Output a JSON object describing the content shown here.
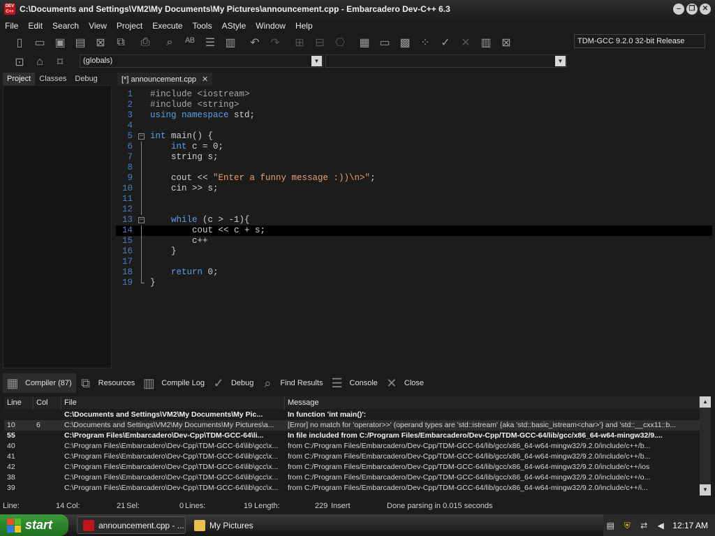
{
  "window": {
    "title": "C:\\Documents and Settings\\VM2\\My Documents\\My Pictures\\announcement.cpp - Embarcadero Dev-C++ 6.3",
    "app_icon_text": "DEV C++",
    "controls": [
      "‒",
      "❐",
      "✕"
    ]
  },
  "menu": [
    "File",
    "Edit",
    "Search",
    "View",
    "Project",
    "Execute",
    "Tools",
    "AStyle",
    "Window",
    "Help"
  ],
  "toolbar": {
    "compiler": "TDM-GCC 9.2.0 32-bit Release",
    "scope": "(globals)"
  },
  "left_tabs": [
    "Project",
    "Classes",
    "Debug"
  ],
  "editor_tab": {
    "label": "[*] announcement.cpp",
    "close": "✕"
  },
  "code_lines": [
    {
      "n": "1",
      "text": "#include <iostream>"
    },
    {
      "n": "2",
      "text": "#include <string>"
    },
    {
      "n": "3",
      "text": "using namespace std;"
    },
    {
      "n": "4",
      "text": ""
    },
    {
      "n": "5",
      "text": "int main() {"
    },
    {
      "n": "6",
      "text": "    int c = 0;"
    },
    {
      "n": "7",
      "text": "    string s;"
    },
    {
      "n": "8",
      "text": ""
    },
    {
      "n": "9",
      "text": "    cout << \"Enter a funny message :))\\n>\";"
    },
    {
      "n": "10",
      "text": "    cin >> s;"
    },
    {
      "n": "11",
      "text": ""
    },
    {
      "n": "12",
      "text": ""
    },
    {
      "n": "13",
      "text": "    while (c > -1){"
    },
    {
      "n": "14",
      "text": "        cout << c + s;"
    },
    {
      "n": "15",
      "text": "        c++"
    },
    {
      "n": "16",
      "text": "    }"
    },
    {
      "n": "17",
      "text": ""
    },
    {
      "n": "18",
      "text": "    return 0;"
    },
    {
      "n": "19",
      "text": "}"
    }
  ],
  "bottom_tabs": [
    {
      "label": "Compiler (87)",
      "icon": "grid-icon"
    },
    {
      "label": "Resources",
      "icon": "resources-icon"
    },
    {
      "label": "Compile Log",
      "icon": "bar-chart-icon"
    },
    {
      "label": "Debug",
      "icon": "check-icon"
    },
    {
      "label": "Find Results",
      "icon": "find-icon"
    },
    {
      "label": "Console",
      "icon": "console-icon"
    },
    {
      "label": "Close",
      "icon": "close-icon"
    }
  ],
  "messages": {
    "headers": [
      "Line",
      "Col",
      "File",
      "Message"
    ],
    "rows": [
      {
        "line": "",
        "col": "",
        "file": "C:\\Documents and Settings\\VM2\\My Documents\\My Pic...",
        "msg": "In function 'int main()':",
        "bold": true
      },
      {
        "line": "10",
        "col": "6",
        "file": "C:\\Documents and Settings\\VM2\\My Documents\\My Pictures\\a...",
        "msg": "[Error] no match for 'operator>>' (operand types are 'std::istream' {aka 'std::basic_istream<char>'} and 'std::__cxx11::b...",
        "bold": false
      },
      {
        "line": "55",
        "col": "",
        "file": "C:\\Program Files\\Embarcadero\\Dev-Cpp\\TDM-GCC-64\\li...",
        "msg": "In file included from C:/Program Files/Embarcadero/Dev-Cpp/TDM-GCC-64/lib/gcc/x86_64-w64-mingw32/9....",
        "bold": true
      },
      {
        "line": "40",
        "col": "",
        "file": "C:\\Program Files\\Embarcadero\\Dev-Cpp\\TDM-GCC-64\\lib\\gcc\\x...",
        "msg": "             from C:/Program Files/Embarcadero/Dev-Cpp/TDM-GCC-64/lib/gcc/x86_64-w64-mingw32/9.2.0/include/c++/b...",
        "bold": false
      },
      {
        "line": "41",
        "col": "",
        "file": "C:\\Program Files\\Embarcadero\\Dev-Cpp\\TDM-GCC-64\\lib\\gcc\\x...",
        "msg": "             from C:/Program Files/Embarcadero/Dev-Cpp/TDM-GCC-64/lib/gcc/x86_64-w64-mingw32/9.2.0/include/c++/b...",
        "bold": false
      },
      {
        "line": "42",
        "col": "",
        "file": "C:\\Program Files\\Embarcadero\\Dev-Cpp\\TDM-GCC-64\\lib\\gcc\\x...",
        "msg": "             from C:/Program Files/Embarcadero/Dev-Cpp/TDM-GCC-64/lib/gcc/x86_64-w64-mingw32/9.2.0/include/c++/ios",
        "bold": false
      },
      {
        "line": "38",
        "col": "",
        "file": "C:\\Program Files\\Embarcadero\\Dev-Cpp\\TDM-GCC-64\\lib\\gcc\\x...",
        "msg": "             from C:/Program Files/Embarcadero/Dev-Cpp/TDM-GCC-64/lib/gcc/x86_64-w64-mingw32/9.2.0/include/c++/o...",
        "bold": false
      },
      {
        "line": "39",
        "col": "",
        "file": "C:\\Program Files\\Embarcadero\\Dev-Cpp\\TDM-GCC-64\\lib\\gcc\\x...",
        "msg": "             from C:/Program Files/Embarcadero/Dev-Cpp/TDM-GCC-64/lib/gcc/x86_64-w64-mingw32/9.2.0/include/c++/i...",
        "bold": false
      }
    ]
  },
  "status": {
    "line_label": "Line:",
    "line_value": "14",
    "col_label": "Col:",
    "col_value": "21",
    "sel_label": "Sel:",
    "sel_value": "0",
    "lines_label": "Lines:",
    "lines_value": "19",
    "length_label": "Length:",
    "length_value": "229",
    "mode": "Insert",
    "message": "Done parsing in 0.015 seconds"
  },
  "taskbar": {
    "start": "start",
    "items": [
      "announcement.cpp - ...",
      "My Pictures"
    ],
    "clock": "12:17 AM"
  }
}
